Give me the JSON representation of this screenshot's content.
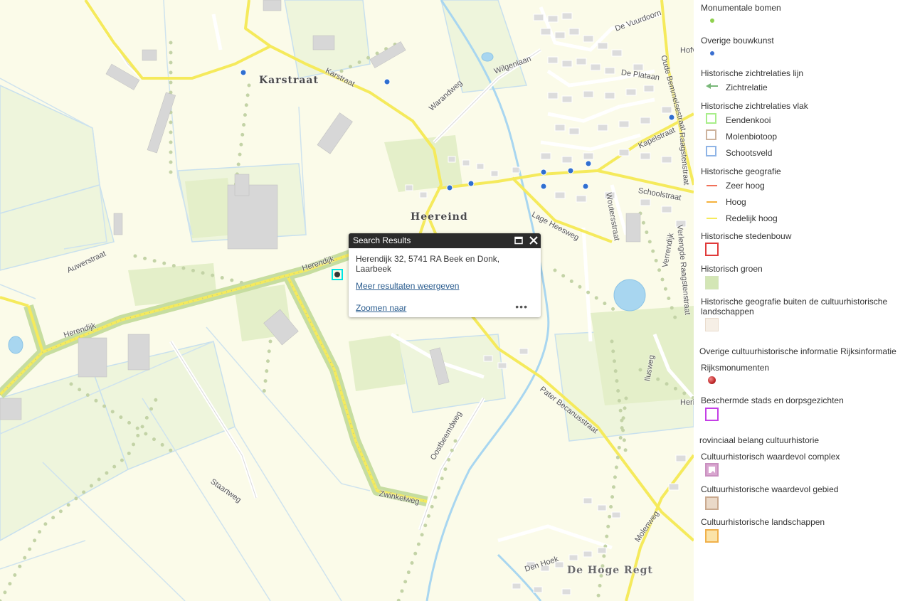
{
  "map": {
    "place_labels": [
      "Karstraat",
      "Heereind",
      "De Hoge Regt"
    ],
    "street_labels": [
      "Karstraat",
      "Warandweg",
      "Wilgenlaan",
      "De Vuurdoorn",
      "Kapelstraat",
      "Schoolstraat",
      "De Plataan",
      "Lage Heesweg",
      "Woutersstraat",
      "Herendijk",
      "Herendijk",
      "Auwerstraat",
      "Oostbeemdweg",
      "Zwinkelweg",
      "Staartweg",
      "Pater Becanusstraat",
      "Molenweg",
      "Den Hoek",
      "Oude Bemmelsestraat",
      "Verrendijk",
      "Ilusweg",
      "Hofv",
      "Herin",
      "Raagstenstraat",
      "Verlengde Raagstenstraat"
    ],
    "road_color": "#f5ea5c",
    "water_color": "#a8d6f0",
    "heritage_green": "#c6dda0",
    "marker_color": "#2f6fd0"
  },
  "popup": {
    "title": "Search Results",
    "address": "Herendijk 32, 5741 RA Beek en Donk, Laarbeek",
    "more_results": "Meer resultaten weergeven",
    "zoom": "Zoomen naar",
    "menu": "•••",
    "maximize_icon": "maximize-icon",
    "close_icon": "close-icon"
  },
  "legend": {
    "monumentale_bomen": "Monumentale bomen",
    "overige_bouwkunst": "Overige bouwkunst",
    "zichtrelaties_lijn": "Historische zichtrelaties lijn",
    "zichtrelatie": "Zichtrelatie",
    "zichtrelaties_vlak": "Historische zichtrelaties vlak",
    "eendenkooi": "Eendenkooi",
    "molenbiotoop": "Molenbiotoop",
    "schootsveld": "Schootsveld",
    "historische_geografie": "Historische geografie",
    "zeer_hoog": "Zeer hoog",
    "hoog": "Hoog",
    "redelijk_hoog": "Redelijk hoog",
    "historische_stedenbouw": "Historische stedenbouw",
    "historisch_groen": "Historisch groen",
    "buiten_line1": "Historische geografie buiten de cultuurhistorische",
    "buiten_line2": "landschappen",
    "overige_info": "Overige cultuurhistorische informatie Rijksinformatie",
    "rijksmonumenten": "Rijksmonumenten",
    "beschermde": "Beschermde stads en dorpsgezichten",
    "provinciaal": "rovinciaal belang cultuurhistorie",
    "complex": "Cultuurhistorisch waardevol complex",
    "gebied": "Cultuurhistorische waardevol gebied",
    "landschappen": "Cultuurhistorische landschappen"
  }
}
